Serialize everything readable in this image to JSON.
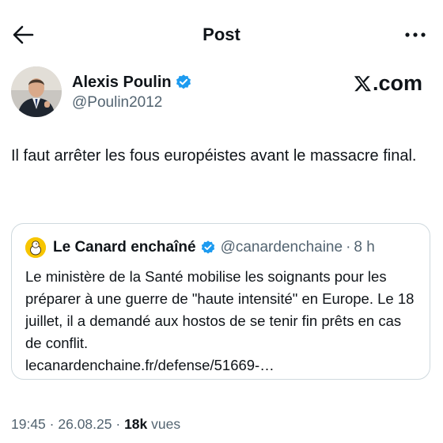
{
  "header": {
    "title": "Post",
    "back_icon": "arrow-left-icon",
    "more_icon": "more-horizontal-icon"
  },
  "author": {
    "name": "Alexis Poulin",
    "handle": "@Poulin2012",
    "verified": true
  },
  "watermark": {
    "brand": ".com",
    "logo_icon": "x-logo-icon"
  },
  "tweet": {
    "text": "Il faut arrêter les fous européistes avant le massacre final."
  },
  "quote": {
    "name": "Le Canard enchaîné",
    "handle": "@canardenchaine",
    "separator": "·",
    "time": "8 h",
    "text": "Le ministère de la Santé mobilise les soignants pour les préparer à une guerre de \"haute intensité\" en Europe. Le 18 juillet, il a demandé aux hostos de se tenir fin prêts en cas de conflit.",
    "link": "lecanardenchaine.fr/defense/51669-…"
  },
  "meta": {
    "time": "19:45",
    "date": "26.08.25",
    "views_count": "18k",
    "views_label": "vues",
    "separator": "·"
  },
  "colors": {
    "text": "#0f1419",
    "secondary": "#536471",
    "verified": "#1d9bf0",
    "border": "#cfd9de",
    "canard_yellow": "#f7c500"
  }
}
